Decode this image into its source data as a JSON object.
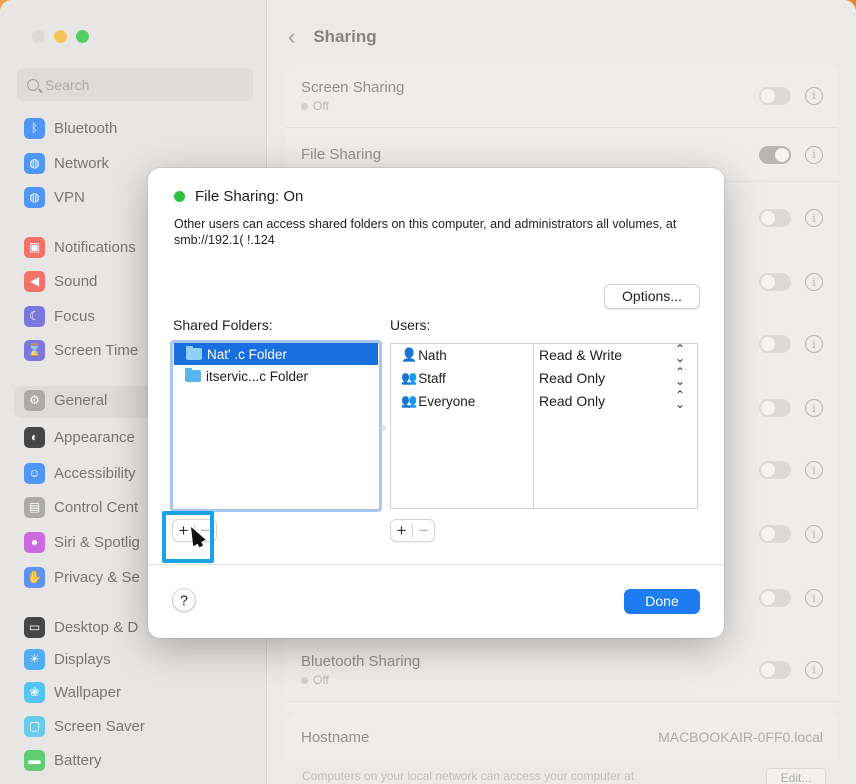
{
  "window": {
    "title": "Sharing"
  },
  "sidebar": {
    "search_placeholder": "Search",
    "items": [
      {
        "label": "Bluetooth",
        "icon": "bluetooth-icon",
        "color": "#2a7ff5"
      },
      {
        "label": "Network",
        "icon": "network-icon",
        "color": "#2a7ff5"
      },
      {
        "label": "VPN",
        "icon": "vpn-icon",
        "color": "#2a7ff5"
      },
      {
        "label": "Notifications",
        "icon": "notifications-icon",
        "color": "#f0534a"
      },
      {
        "label": "Sound",
        "icon": "sound-icon",
        "color": "#f0534a"
      },
      {
        "label": "Focus",
        "icon": "focus-icon",
        "color": "#5f5ad8"
      },
      {
        "label": "Screen Time",
        "icon": "screen-time-icon",
        "color": "#5f5ad8"
      },
      {
        "label": "General",
        "icon": "general-icon",
        "color": "#9a9895"
      },
      {
        "label": "Appearance",
        "icon": "appearance-icon",
        "color": "#1d1d1d"
      },
      {
        "label": "Accessibility",
        "icon": "accessibility-icon",
        "color": "#2a7ff5"
      },
      {
        "label": "Control Cent",
        "icon": "control-center-icon",
        "color": "#9a9895"
      },
      {
        "label": "Siri & Spotlig",
        "icon": "siri-icon",
        "color": "#c04bd8"
      },
      {
        "label": "Privacy & Se",
        "icon": "privacy-icon",
        "color": "#3c7cf0"
      },
      {
        "label": "Desktop & D",
        "icon": "desktop-dock-icon",
        "color": "#1d1d1d"
      },
      {
        "label": "Displays",
        "icon": "displays-icon",
        "color": "#2a9cf5"
      },
      {
        "label": "Wallpaper",
        "icon": "wallpaper-icon",
        "color": "#30b8f0"
      },
      {
        "label": "Screen Saver",
        "icon": "screen-saver-icon",
        "color": "#48c0e8"
      },
      {
        "label": "Battery",
        "icon": "battery-icon",
        "color": "#3fc456"
      }
    ]
  },
  "main": {
    "rows": [
      {
        "label": "Screen Sharing",
        "sub": "Off",
        "on": false
      },
      {
        "label": "File Sharing",
        "sub": "",
        "on": true
      },
      {
        "label": "Bluetooth Sharing",
        "sub": "Off",
        "on": false
      }
    ],
    "hostname_label": "Hostname",
    "hostname_value": "MACBOOKAIR-0FF0.local",
    "footnote": "Computers on your local network can access your computer at",
    "edit_label": "Edit..."
  },
  "dialog": {
    "status": "File Sharing: On",
    "status_color": "#2cc23e",
    "description": "Other users can access shared folders on this computer, and administrators all volumes, at smb://192.1(      !.124",
    "options_label": "Options...",
    "shared_folders_label": "Shared Folders:",
    "users_label": "Users:",
    "folders": [
      {
        "name": "Nat'       .c Folder",
        "selected": true
      },
      {
        "name": "itservic...c Folder",
        "selected": false
      }
    ],
    "users": [
      {
        "name": "Nath",
        "permission": "Read & Write",
        "icon": "single-user-icon"
      },
      {
        "name": "Staff",
        "permission": "Read Only",
        "icon": "group-icon"
      },
      {
        "name": "Everyone",
        "permission": "Read Only",
        "icon": "everyone-icon"
      }
    ],
    "plus": "+",
    "minus": "−",
    "help": "?",
    "done_label": "Done"
  }
}
